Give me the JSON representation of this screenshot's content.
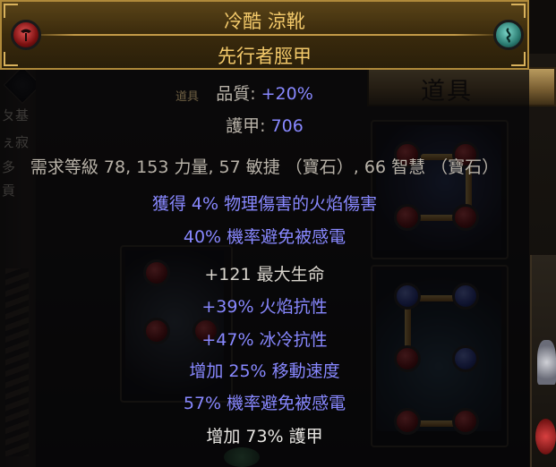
{
  "background": {
    "stash_tab_label": "道具",
    "left_fragments": [
      "坮",
      "ㄆ基",
      "ぇ寂",
      "多",
      "貢"
    ],
    "tooltip_overlap_label": "道具"
  },
  "item": {
    "rarity_color": "#f3c96a",
    "name": "冷酷 涼靴",
    "base_type": "先行者脛甲",
    "quality_label": "品質: ",
    "quality_value": "+20%",
    "armour_label": "護甲: ",
    "armour_value": "706",
    "requirements": "需求等級 78, 153 力量, 57 敏捷 （寶石）, 66 智慧 （寶石）",
    "implicit_mods": [
      "獲得 4% 物理傷害的火焰傷害",
      "40% 機率避免被感電"
    ],
    "explicit_mods": [
      "+121 最大生命",
      "+39% 火焰抗性",
      "+47% 冰冷抗性",
      "增加 25% 移動速度",
      "57% 機率避免被感電",
      "增加 73% 護甲"
    ],
    "influence_icons": [
      "warlord-influence-icon",
      "hunter-influence-icon"
    ]
  }
}
